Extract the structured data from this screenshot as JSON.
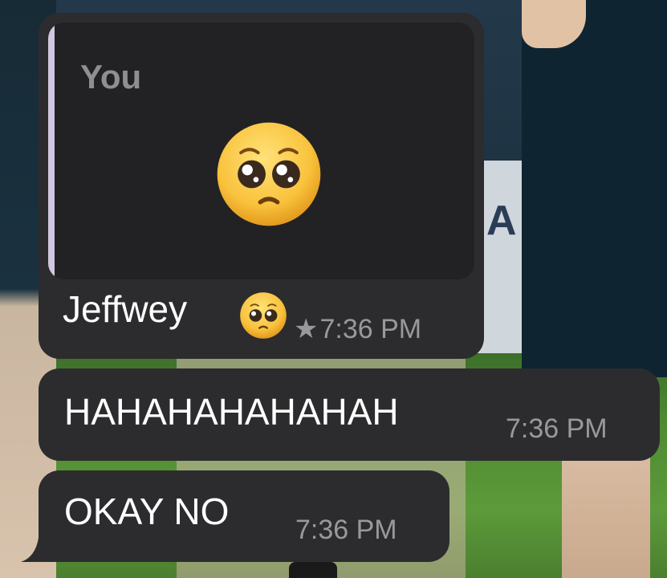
{
  "messages": [
    {
      "quote": {
        "author": "You",
        "content_icon": "pleading-face-emoji"
      },
      "text": "Jeffwey",
      "trailing_icon": "pleading-face-emoji",
      "starred": true,
      "star_glyph": "★",
      "time": "7:36 PM"
    },
    {
      "text": "HAHAHAHAHAHAH",
      "time": "7:36 PM"
    },
    {
      "text": "OKAY NO",
      "time": "7:36 PM"
    }
  ],
  "colors": {
    "bubble": "#2c2c2e",
    "quote_bg": "#222224",
    "quote_bar": "#d0c8e0",
    "text": "#ffffff",
    "time": "#98989d"
  }
}
